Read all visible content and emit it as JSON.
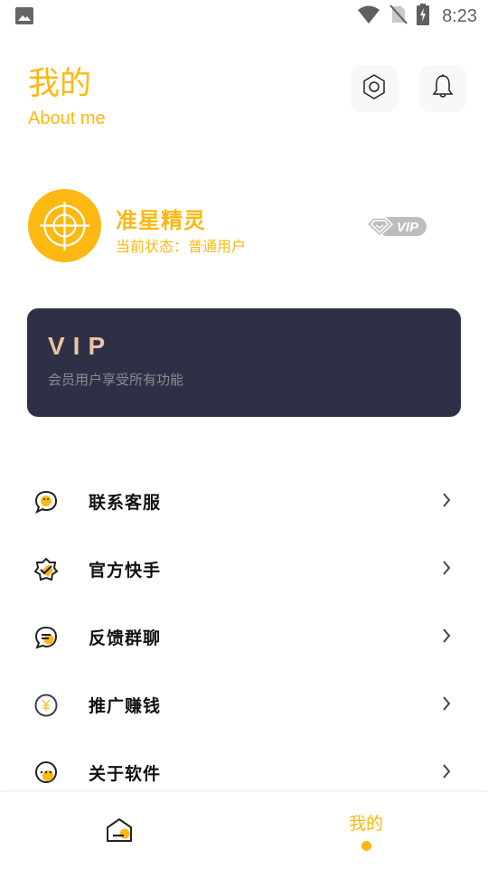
{
  "status_bar": {
    "time": "8:23",
    "icons": [
      "image-icon",
      "wifi-icon",
      "no-sim-icon",
      "battery-charging-icon"
    ]
  },
  "header": {
    "title": "我的",
    "subtitle": "About me",
    "settings_icon": "settings-hexagon-icon",
    "notification_icon": "bell-icon"
  },
  "profile": {
    "name": "准星精灵",
    "status": "当前状态：普通用户",
    "badge": "VIP",
    "avatar_icon": "crosshair-icon"
  },
  "vip_card": {
    "title": "VIP",
    "description": "会员用户享受所有功能"
  },
  "menu": {
    "items": [
      {
        "label": "联系客服",
        "icon": "customer-service-icon"
      },
      {
        "label": "官方快手",
        "icon": "verified-badge-icon"
      },
      {
        "label": "反馈群聊",
        "icon": "group-chat-icon"
      },
      {
        "label": "推广赚钱",
        "icon": "yuan-coin-icon"
      },
      {
        "label": "关于软件",
        "icon": "about-chat-icon"
      }
    ]
  },
  "bottom_nav": {
    "items": [
      {
        "label": "",
        "icon": "home-icon",
        "active": false
      },
      {
        "label": "我的",
        "active": true
      }
    ]
  },
  "colors": {
    "accent": "#FDB811",
    "vip_card_bg": "#2E3146",
    "vip_title": "#E9C4A4",
    "vip_desc": "#8E8A8C"
  }
}
